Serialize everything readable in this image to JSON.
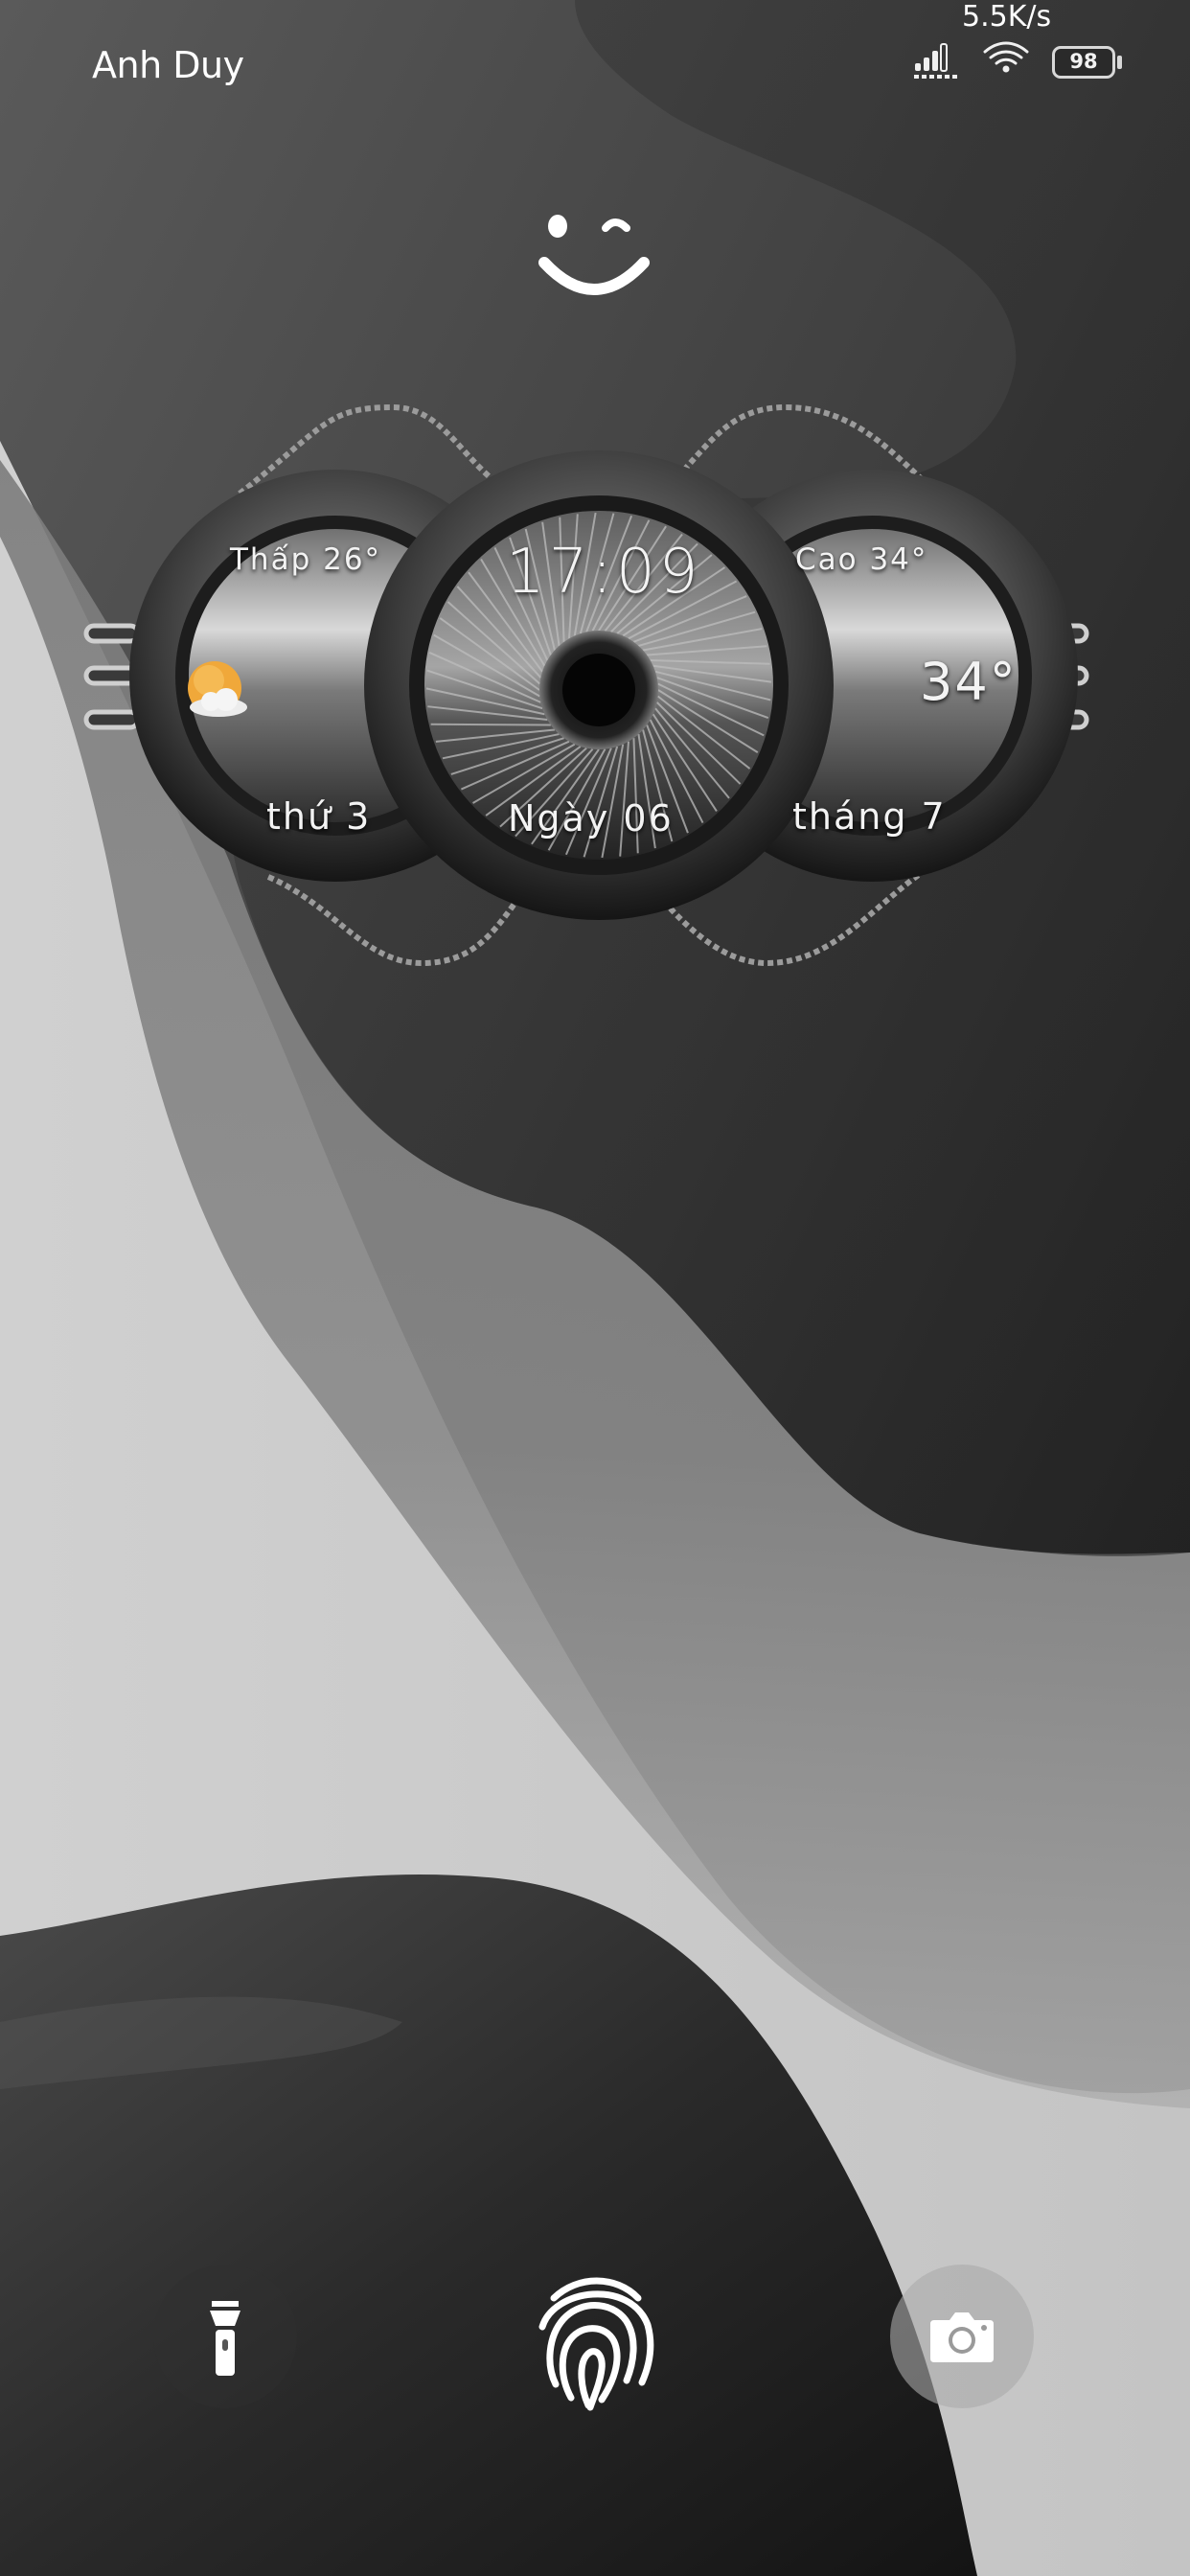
{
  "status_bar": {
    "user_name": "Anh Duy",
    "network_speed": "5.5K/s",
    "battery_percent": "98",
    "icons": [
      "signal-icon",
      "wifi-icon",
      "battery-icon"
    ]
  },
  "lock_face": {
    "icon": "smiley-face-icon"
  },
  "widget": {
    "low_temp": "Thấp 26°",
    "high_temp": "Cao 34°",
    "time": "17:09",
    "current_temp": "34°",
    "weekday": "thứ 3",
    "day": "Ngày 06",
    "month": "tháng 7",
    "weather_icon": "partly-cloudy-sun-icon"
  },
  "bottom_bar": {
    "left": "flashlight-icon",
    "center": "fingerprint-icon",
    "right": "camera-icon"
  },
  "colors": {
    "accent_sun": "#f0a83a",
    "text": "#ffffff"
  }
}
